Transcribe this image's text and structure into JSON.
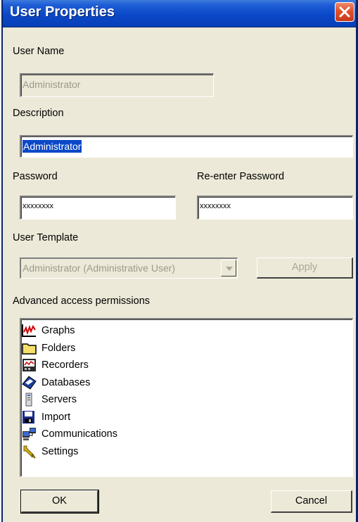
{
  "window": {
    "title": "User Properties",
    "close_label": "×"
  },
  "form": {
    "user_name_label": "User Name",
    "user_name_value": "Administrator",
    "description_label": "Description",
    "description_value": "Administrator",
    "password_label": "Password",
    "password_value": "xxxxxxxx",
    "reenter_password_label": "Re-enter Password",
    "reenter_password_value": "xxxxxxxx",
    "user_template_label": "User Template",
    "user_template_value": "Administrator (Administrative User)",
    "apply_label": "Apply",
    "permissions_label": "Advanced access permissions"
  },
  "permissions": [
    {
      "label": "Graphs",
      "icon": "graph-icon"
    },
    {
      "label": "Folders",
      "icon": "folder-icon"
    },
    {
      "label": "Recorders",
      "icon": "recorder-icon"
    },
    {
      "label": "Databases",
      "icon": "database-icon"
    },
    {
      "label": "Servers",
      "icon": "server-icon"
    },
    {
      "label": "Import",
      "icon": "import-icon"
    },
    {
      "label": "Communications",
      "icon": "communications-icon"
    },
    {
      "label": "Settings",
      "icon": "wrench-icon"
    }
  ],
  "buttons": {
    "ok_label": "OK",
    "cancel_label": "Cancel"
  },
  "colors": {
    "titlebar": "#0a48c8",
    "dialog_bg": "#ece9d8",
    "selection": "#0a48c8",
    "close_button": "#e0522b"
  }
}
